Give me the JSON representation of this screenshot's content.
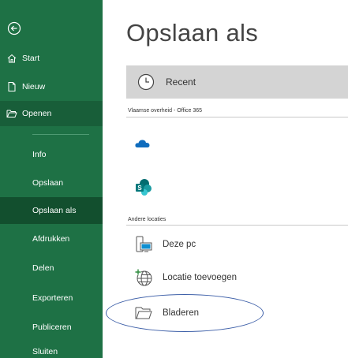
{
  "sidebar": {
    "items": [
      {
        "label": "Start",
        "icon": "home-icon"
      },
      {
        "label": "Nieuw",
        "icon": "new-document-icon"
      },
      {
        "label": "Openen",
        "icon": "open-folder-icon"
      },
      {
        "label": "Info"
      },
      {
        "label": "Opslaan"
      },
      {
        "label": "Opslaan als"
      },
      {
        "label": "Afdrukken"
      },
      {
        "label": "Delen"
      },
      {
        "label": "Exporteren"
      },
      {
        "label": "Publiceren"
      },
      {
        "label": "Sluiten"
      }
    ],
    "selected": "Opslaan als",
    "colors": {
      "background": "#1e7145",
      "selected": "#124f2e",
      "hover": "#185e39"
    }
  },
  "main": {
    "title": "Opslaan als",
    "recent": {
      "label": "Recent",
      "icon": "clock-icon"
    },
    "sections": [
      {
        "label": "Vlaamse overheid - Office 365"
      },
      {
        "label": "Andere locaties"
      }
    ],
    "cloud_locations": [
      {
        "icon": "onedrive-icon"
      },
      {
        "icon": "sharepoint-icon"
      }
    ],
    "other_locations": [
      {
        "label": "Deze pc",
        "icon": "computer-icon"
      },
      {
        "label": "Locatie toevoegen",
        "icon": "add-location-globe-icon"
      },
      {
        "label": "Bladeren",
        "icon": "folder-icon"
      }
    ],
    "highlight_color": "#3d5fa8"
  }
}
